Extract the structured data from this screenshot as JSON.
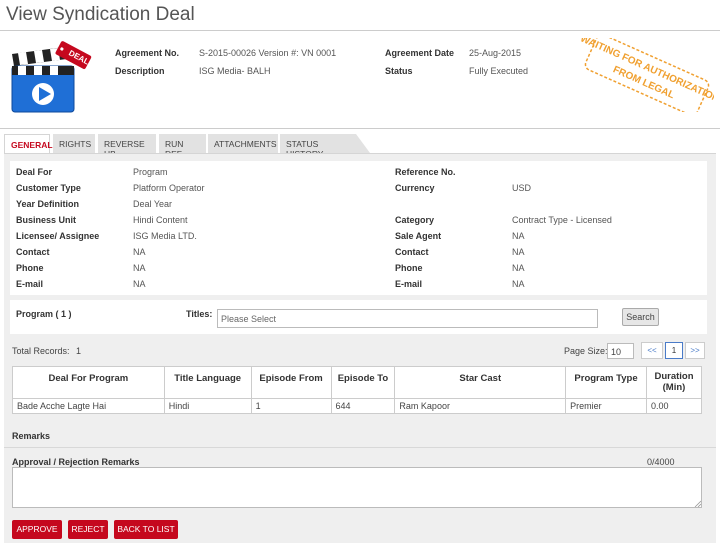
{
  "page": {
    "title": "View Syndication Deal"
  },
  "logo": {
    "ribbon_text": "DEAL",
    "icon": "film-clapper-play-icon"
  },
  "header": {
    "agreement_no_label": "Agreement No.",
    "agreement_no_value": "S-2015-00026 Version #: VN 0001",
    "description_label": "Description",
    "description_value": "ISG Media- BALH",
    "agreement_date_label": "Agreement Date",
    "agreement_date_value": "25-Aug-2015",
    "status_label": "Status",
    "status_value": "Fully Executed"
  },
  "stamp": {
    "line1": "WAITING FOR AUTHORIZATION",
    "line2": "FROM LEGAL",
    "color": "#f0a030"
  },
  "tabs": [
    {
      "label": "GENERAL",
      "active": true
    },
    {
      "label": "RIGHTS",
      "active": false
    },
    {
      "label": "REVERSE HB",
      "active": false
    },
    {
      "label": "RUN DEF",
      "active": false
    },
    {
      "label": "ATTACHMENTS",
      "active": false
    },
    {
      "label": "STATUS HISTORY",
      "active": false
    }
  ],
  "general": {
    "left": [
      {
        "label": "Deal For",
        "value": "Program"
      },
      {
        "label": "Customer Type",
        "value": "Platform Operator"
      },
      {
        "label": "Year Definition",
        "value": "Deal Year"
      },
      {
        "label": "Business Unit",
        "value": "Hindi Content"
      },
      {
        "label": "Licensee/ Assignee",
        "value": "ISG Media LTD."
      },
      {
        "label": "Contact",
        "value": "NA"
      },
      {
        "label": "Phone",
        "value": "NA"
      },
      {
        "label": "E-mail",
        "value": "NA"
      }
    ],
    "right": [
      {
        "label": "Reference No.",
        "value": ""
      },
      {
        "label": "Currency",
        "value": "USD"
      },
      {
        "label": "",
        "value": ""
      },
      {
        "label": "Category",
        "value": "Contract Type - Licensed"
      },
      {
        "label": "Sale Agent",
        "value": "NA"
      },
      {
        "label": "Contact",
        "value": "NA"
      },
      {
        "label": "Phone",
        "value": "NA"
      },
      {
        "label": "E-mail",
        "value": "NA"
      }
    ]
  },
  "program_filter": {
    "program_label": "Program ( 1 )",
    "titles_label": "Titles:",
    "titles_placeholder": "Please Select",
    "search_label": "Search"
  },
  "records": {
    "total_label": "Total Records:",
    "total_value": "1",
    "page_size_label": "Page Size:",
    "page_size_value": "10",
    "prev_label": "<<",
    "current_page": "1",
    "next_label": ">>"
  },
  "table": {
    "headers": [
      "Deal For Program",
      "Title Language",
      "Episode From",
      "Episode To",
      "Star Cast",
      "Program Type",
      "Duration (Min)"
    ],
    "rows": [
      [
        "Bade Acche Lagte Hai",
        "Hindi",
        "1",
        "644",
        "Ram Kapoor",
        "Premier",
        "0.00"
      ]
    ]
  },
  "remarks": {
    "remarks_label": "Remarks",
    "approval_label": "Approval / Rejection Remarks",
    "counter": "0/4000"
  },
  "actions": {
    "approve_label": "APPROVE",
    "reject_label": "REJECT",
    "back_label": "BACK TO LIST"
  },
  "colors": {
    "accent_red": "#c5081e",
    "link_blue": "#4a7bc8"
  }
}
